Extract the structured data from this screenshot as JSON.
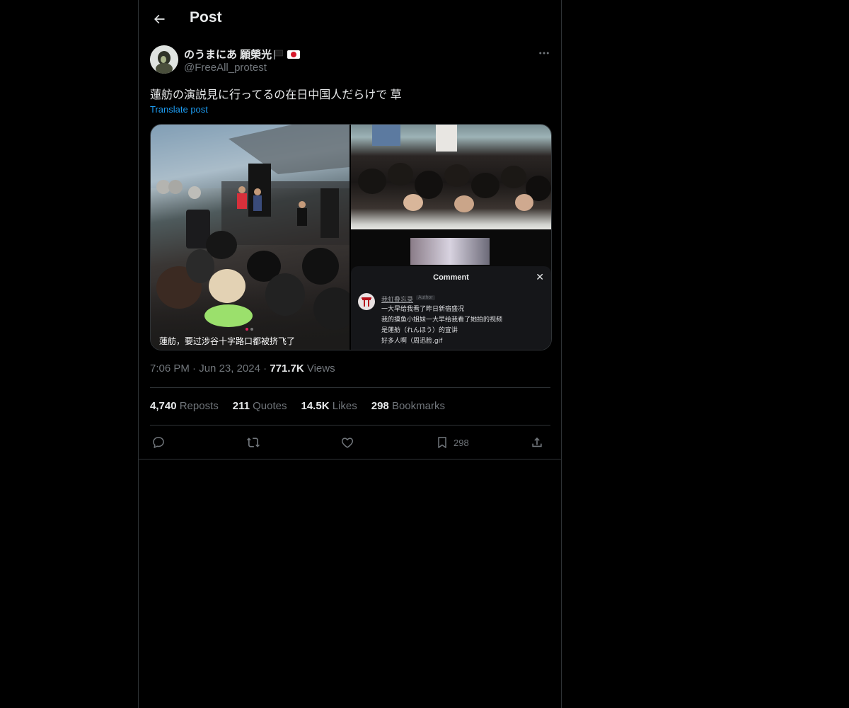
{
  "header": {
    "title": "Post"
  },
  "post": {
    "display_name": "のうまにあ 願榮光",
    "handle": "@FreeAll_protest",
    "text": "蓮舫の演説見に行ってるの在日中国人だらけで 草",
    "translate_label": "Translate post",
    "media": {
      "image1_caption": "蓮舫，要过涉谷十字路口都被挤飞了",
      "comment_panel": {
        "title": "Comment",
        "author": "我虹叠忘录",
        "author_tag": "Author",
        "lines": [
          "一大早给我看了昨日新宿盛况",
          "我的摸鱼小姐妹一大早给我看了她拍的视频",
          "是蓮舫（れんほう）的宣讲",
          "好多人啊（周迅脸.gif"
        ]
      }
    },
    "time": "7:06 PM",
    "date": "Jun 23, 2024",
    "views_count": "771.7K",
    "views_label": "Views"
  },
  "stats": {
    "reposts_count": "4,740",
    "reposts_label": "Reposts",
    "quotes_count": "211",
    "quotes_label": "Quotes",
    "likes_count": "14.5K",
    "likes_label": "Likes",
    "bookmarks_count": "298",
    "bookmarks_label": "Bookmarks"
  },
  "actions": {
    "bookmark_count": "298"
  },
  "icons": {
    "back": "arrow-left-icon",
    "more": "more-horizontal-icon",
    "reply": "reply-icon",
    "repost": "repost-icon",
    "like": "heart-icon",
    "bookmark": "bookmark-icon",
    "share": "share-icon"
  },
  "colors": {
    "background": "#000000",
    "text": "#e7e9ea",
    "secondary": "#71767b",
    "accent": "#1d9bf0",
    "border": "#2f3336"
  }
}
